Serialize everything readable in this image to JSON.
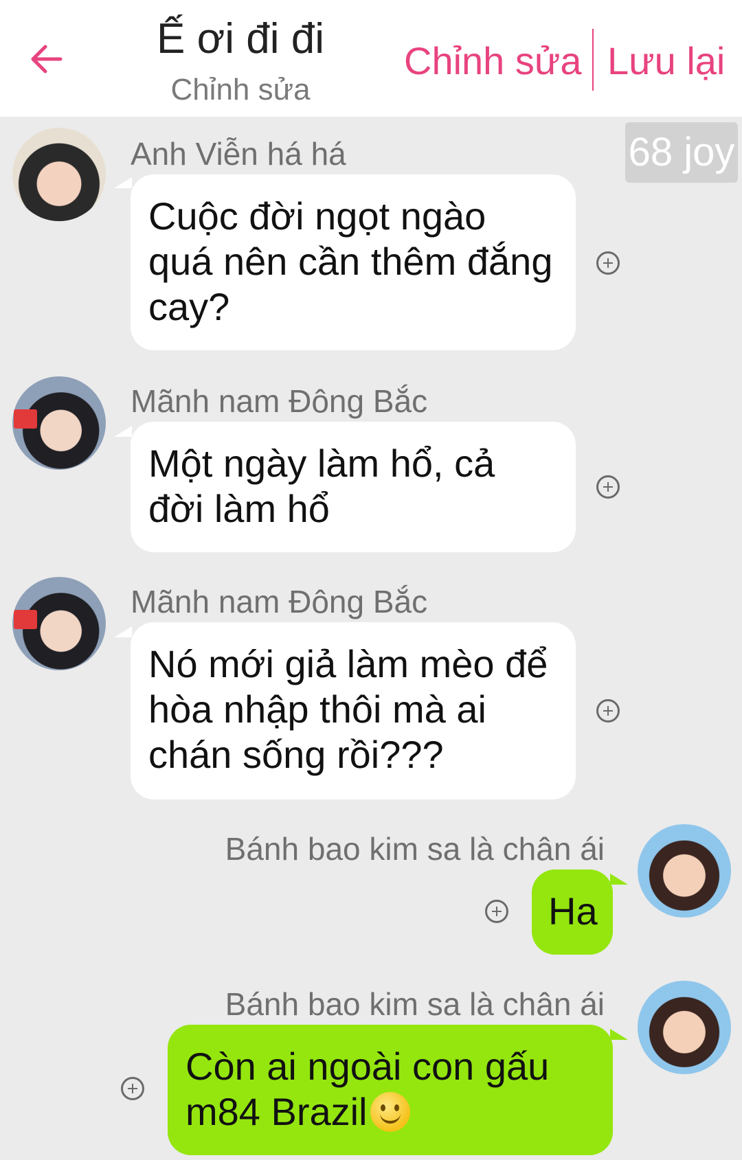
{
  "header": {
    "title": "Ế ơi đi đi",
    "subtitle": "Chỉnh sửa",
    "edit_label": "Chỉnh sửa",
    "save_label": "Lưu lại"
  },
  "joy_badge": "68 joy",
  "messages": [
    {
      "sender": "Anh Viễn há há",
      "text": "Cuộc đời ngọt ngào quá nên cần thêm đắng cay?",
      "side": "left"
    },
    {
      "sender": "Mãnh nam Đông Bắc",
      "text": "Một ngày làm hổ, cả đời làm hổ",
      "side": "left"
    },
    {
      "sender": "Mãnh nam Đông Bắc",
      "text": "Nó mới giả làm mèo để hòa nhập thôi mà ai chán sống rồi???",
      "side": "left"
    },
    {
      "sender": "Bánh bao kim sa là chân ái",
      "text": "Ha",
      "side": "right"
    },
    {
      "sender": "Bánh bao kim sa là chân ái",
      "text": "Còn ai ngoài con gấu m84 Brazil",
      "side": "right",
      "emoji": "smiley-emoji"
    }
  ],
  "colors": {
    "accent": "#e8437f",
    "background": "#ebebeb",
    "bubble_left": "#ffffff",
    "bubble_right": "#94e60e"
  }
}
